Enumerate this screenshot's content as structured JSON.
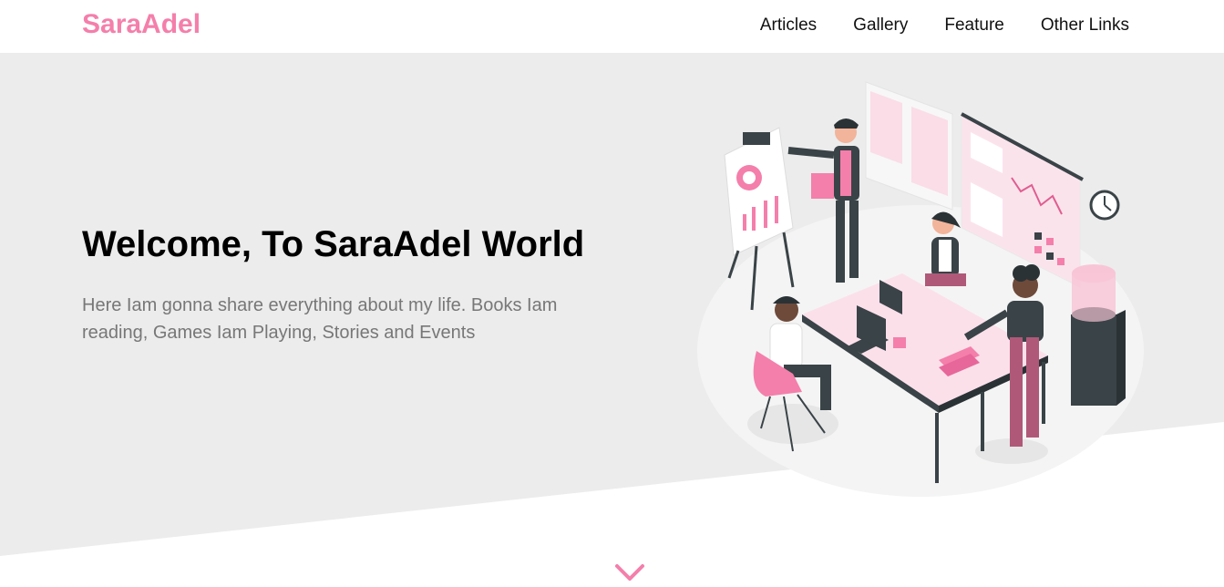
{
  "header": {
    "logo": "SaraAdel",
    "nav": [
      {
        "label": "Articles"
      },
      {
        "label": "Gallery"
      },
      {
        "label": "Feature"
      },
      {
        "label": "Other Links"
      }
    ]
  },
  "landing": {
    "title": "Welcome, To SaraAdel World",
    "description": "Here Iam gonna share everything about my life. Books Iam reading, Games Iam Playing, Stories and Events"
  },
  "colors": {
    "accent": "#f47faa",
    "landing_bg": "#ececec",
    "text_dark": "#000000",
    "text_muted": "#777777"
  },
  "icons": {
    "scroll": "chevron-down-icon"
  }
}
